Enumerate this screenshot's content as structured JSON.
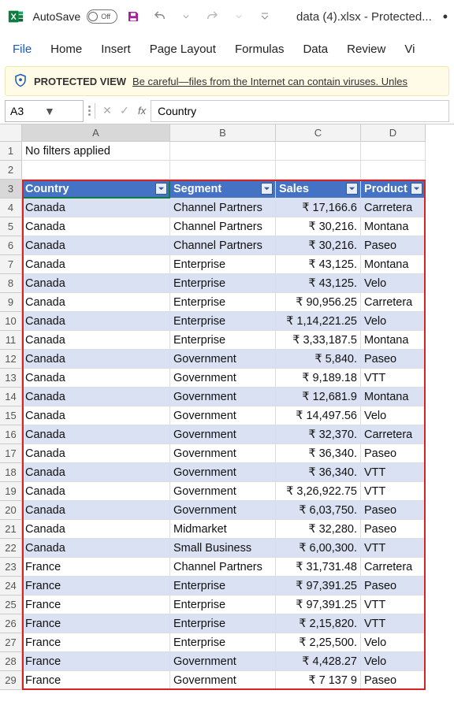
{
  "titlebar": {
    "autosave_label": "AutoSave",
    "autosave_state": "Off",
    "doc_title": "data (4).xlsx - Protected...",
    "trail": "•"
  },
  "ribbon": {
    "tabs": [
      "File",
      "Home",
      "Insert",
      "Page Layout",
      "Formulas",
      "Data",
      "Review",
      "Vi"
    ]
  },
  "protected_view": {
    "label": "PROTECTED VIEW",
    "message": "Be careful—files from the Internet can contain viruses. Unles"
  },
  "namebox": {
    "ref": "A3"
  },
  "formula_bar": {
    "value": "Country"
  },
  "grid": {
    "columns": [
      "A",
      "B",
      "C",
      "D"
    ],
    "row1": {
      "A": "No filters applied"
    },
    "headers": {
      "country": "Country",
      "segment": "Segment",
      "sales": "Sales",
      "product": "Product"
    },
    "rows": [
      {
        "n": 4,
        "country": "Canada",
        "segment": "Channel Partners",
        "sales": "₹ 17,166.6",
        "product": "Carretera"
      },
      {
        "n": 5,
        "country": "Canada",
        "segment": "Channel Partners",
        "sales": "₹ 30,216.",
        "product": "Montana"
      },
      {
        "n": 6,
        "country": "Canada",
        "segment": "Channel Partners",
        "sales": "₹ 30,216.",
        "product": "Paseo"
      },
      {
        "n": 7,
        "country": "Canada",
        "segment": "Enterprise",
        "sales": "₹ 43,125.",
        "product": "Montana"
      },
      {
        "n": 8,
        "country": "Canada",
        "segment": "Enterprise",
        "sales": "₹ 43,125.",
        "product": "Velo"
      },
      {
        "n": 9,
        "country": "Canada",
        "segment": "Enterprise",
        "sales": "₹ 90,956.25",
        "product": "Carretera"
      },
      {
        "n": 10,
        "country": "Canada",
        "segment": "Enterprise",
        "sales": "₹ 1,14,221.25",
        "product": "Velo"
      },
      {
        "n": 11,
        "country": "Canada",
        "segment": "Enterprise",
        "sales": "₹ 3,33,187.5",
        "product": "Montana"
      },
      {
        "n": 12,
        "country": "Canada",
        "segment": "Government",
        "sales": "₹ 5,840.",
        "product": "Paseo"
      },
      {
        "n": 13,
        "country": "Canada",
        "segment": "Government",
        "sales": "₹ 9,189.18",
        "product": "VTT"
      },
      {
        "n": 14,
        "country": "Canada",
        "segment": "Government",
        "sales": "₹ 12,681.9",
        "product": "Montana"
      },
      {
        "n": 15,
        "country": "Canada",
        "segment": "Government",
        "sales": "₹ 14,497.56",
        "product": "Velo"
      },
      {
        "n": 16,
        "country": "Canada",
        "segment": "Government",
        "sales": "₹ 32,370.",
        "product": "Carretera"
      },
      {
        "n": 17,
        "country": "Canada",
        "segment": "Government",
        "sales": "₹ 36,340.",
        "product": "Paseo"
      },
      {
        "n": 18,
        "country": "Canada",
        "segment": "Government",
        "sales": "₹ 36,340.",
        "product": "VTT"
      },
      {
        "n": 19,
        "country": "Canada",
        "segment": "Government",
        "sales": "₹ 3,26,922.75",
        "product": "VTT"
      },
      {
        "n": 20,
        "country": "Canada",
        "segment": "Government",
        "sales": "₹ 6,03,750.",
        "product": "Paseo"
      },
      {
        "n": 21,
        "country": "Canada",
        "segment": "Midmarket",
        "sales": "₹ 32,280.",
        "product": "Paseo"
      },
      {
        "n": 22,
        "country": "Canada",
        "segment": "Small Business",
        "sales": "₹ 6,00,300.",
        "product": "VTT"
      },
      {
        "n": 23,
        "country": "France",
        "segment": "Channel Partners",
        "sales": "₹ 31,731.48",
        "product": "Carretera"
      },
      {
        "n": 24,
        "country": "France",
        "segment": "Enterprise",
        "sales": "₹ 97,391.25",
        "product": "Paseo"
      },
      {
        "n": 25,
        "country": "France",
        "segment": "Enterprise",
        "sales": "₹ 97,391.25",
        "product": "VTT"
      },
      {
        "n": 26,
        "country": "France",
        "segment": "Enterprise",
        "sales": "₹ 2,15,820.",
        "product": "VTT"
      },
      {
        "n": 27,
        "country": "France",
        "segment": "Enterprise",
        "sales": "₹ 2,25,500.",
        "product": "Velo"
      },
      {
        "n": 28,
        "country": "France",
        "segment": "Government",
        "sales": "₹ 4,428.27",
        "product": "Velo"
      },
      {
        "n": 29,
        "country": "France",
        "segment": "Government",
        "sales": "₹ 7 137 9",
        "product": "Paseo"
      }
    ]
  }
}
